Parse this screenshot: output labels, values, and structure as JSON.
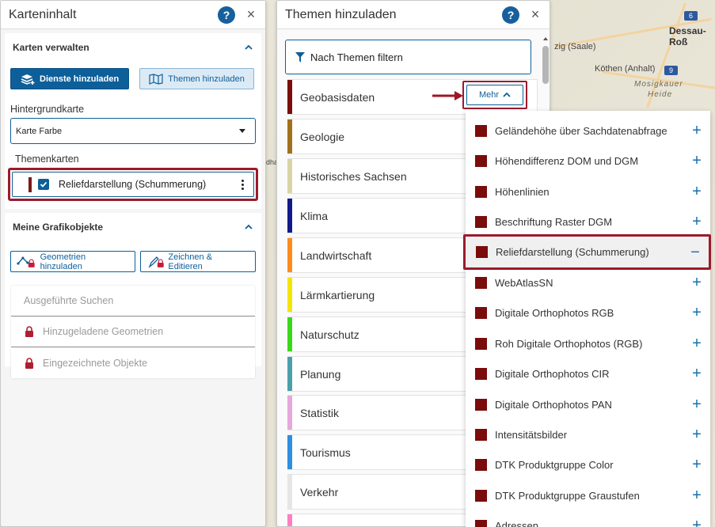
{
  "map": {
    "labels": [
      "Dessau-Roß",
      "zig (Saale)",
      "Köthen (Anhalt)",
      "Mosigkauer",
      "Heide",
      "dha"
    ],
    "road_shields": [
      "9",
      "6"
    ]
  },
  "left_panel": {
    "title": "Karteninhalt",
    "help_label": "?",
    "close_label": "×",
    "manage": {
      "heading": "Karten verwalten",
      "btn_services": "Dienste hinzuladen",
      "btn_themes": "Themen hinzuladen",
      "basemap_label": "Hintergrundkarte",
      "basemap_value": "Karte Farbe",
      "themes_label": "Themenkarten",
      "layer_name": "Reliefdarstellung (Schummerung)",
      "layer_color": "#7a1a1a"
    },
    "graphics": {
      "heading": "Meine Grafikobjekte",
      "btn_geometries": "Geometrien hinzuladen",
      "btn_draw": "Zeichnen & Editieren",
      "list": [
        "Ausgeführte Suchen",
        "Hinzugeladene Geometrien",
        "Eingezeichnete Objekte"
      ]
    }
  },
  "mid_panel": {
    "title": "Themen hinzuladen",
    "help_label": "?",
    "close_label": "×",
    "filter_label": "Nach Themen filtern",
    "mehr_label": "Mehr",
    "themes": [
      {
        "label": "Geobasisdaten",
        "color": "#7a0c0c"
      },
      {
        "label": "Geologie",
        "color": "#a0701c"
      },
      {
        "label": "Historisches Sachsen",
        "color": "#d8d4a8"
      },
      {
        "label": "Klima",
        "color": "#101a8a"
      },
      {
        "label": "Landwirtschaft",
        "color": "#ff8c1a"
      },
      {
        "label": "Lärmkartierung",
        "color": "#f5e400"
      },
      {
        "label": "Naturschutz",
        "color": "#3ad81a"
      },
      {
        "label": "Planung",
        "color": "#4aa0a8"
      },
      {
        "label": "Statistik",
        "color": "#e6a8dc"
      },
      {
        "label": "Tourismus",
        "color": "#2e8ee0"
      },
      {
        "label": "Verkehr",
        "color": "#e6e6e6"
      }
    ]
  },
  "dropdown": {
    "items": [
      {
        "label": "Geländehöhe über Sachdatenabfrage",
        "action": "+"
      },
      {
        "label": "Höhendifferenz DOM und DGM",
        "action": "+"
      },
      {
        "label": "Höhenlinien",
        "action": "+"
      },
      {
        "label": "Beschriftung Raster DGM",
        "action": "+"
      },
      {
        "label": "Reliefdarstellung (Schummerung)",
        "action": "−"
      },
      {
        "label": "WebAtlasSN",
        "action": "+"
      },
      {
        "label": "Digitale Orthophotos RGB",
        "action": "+"
      },
      {
        "label": "Roh Digitale Orthophotos (RGB)",
        "action": "+"
      },
      {
        "label": "Digitale Orthophotos CIR",
        "action": "+"
      },
      {
        "label": "Digitale Orthophotos PAN",
        "action": "+"
      },
      {
        "label": "Intensitätsbilder",
        "action": "+"
      },
      {
        "label": "DTK Produktgruppe Color",
        "action": "+"
      },
      {
        "label": "DTK Produktgruppe Graustufen",
        "action": "+"
      },
      {
        "label": "Adressen",
        "action": "+"
      }
    ]
  }
}
